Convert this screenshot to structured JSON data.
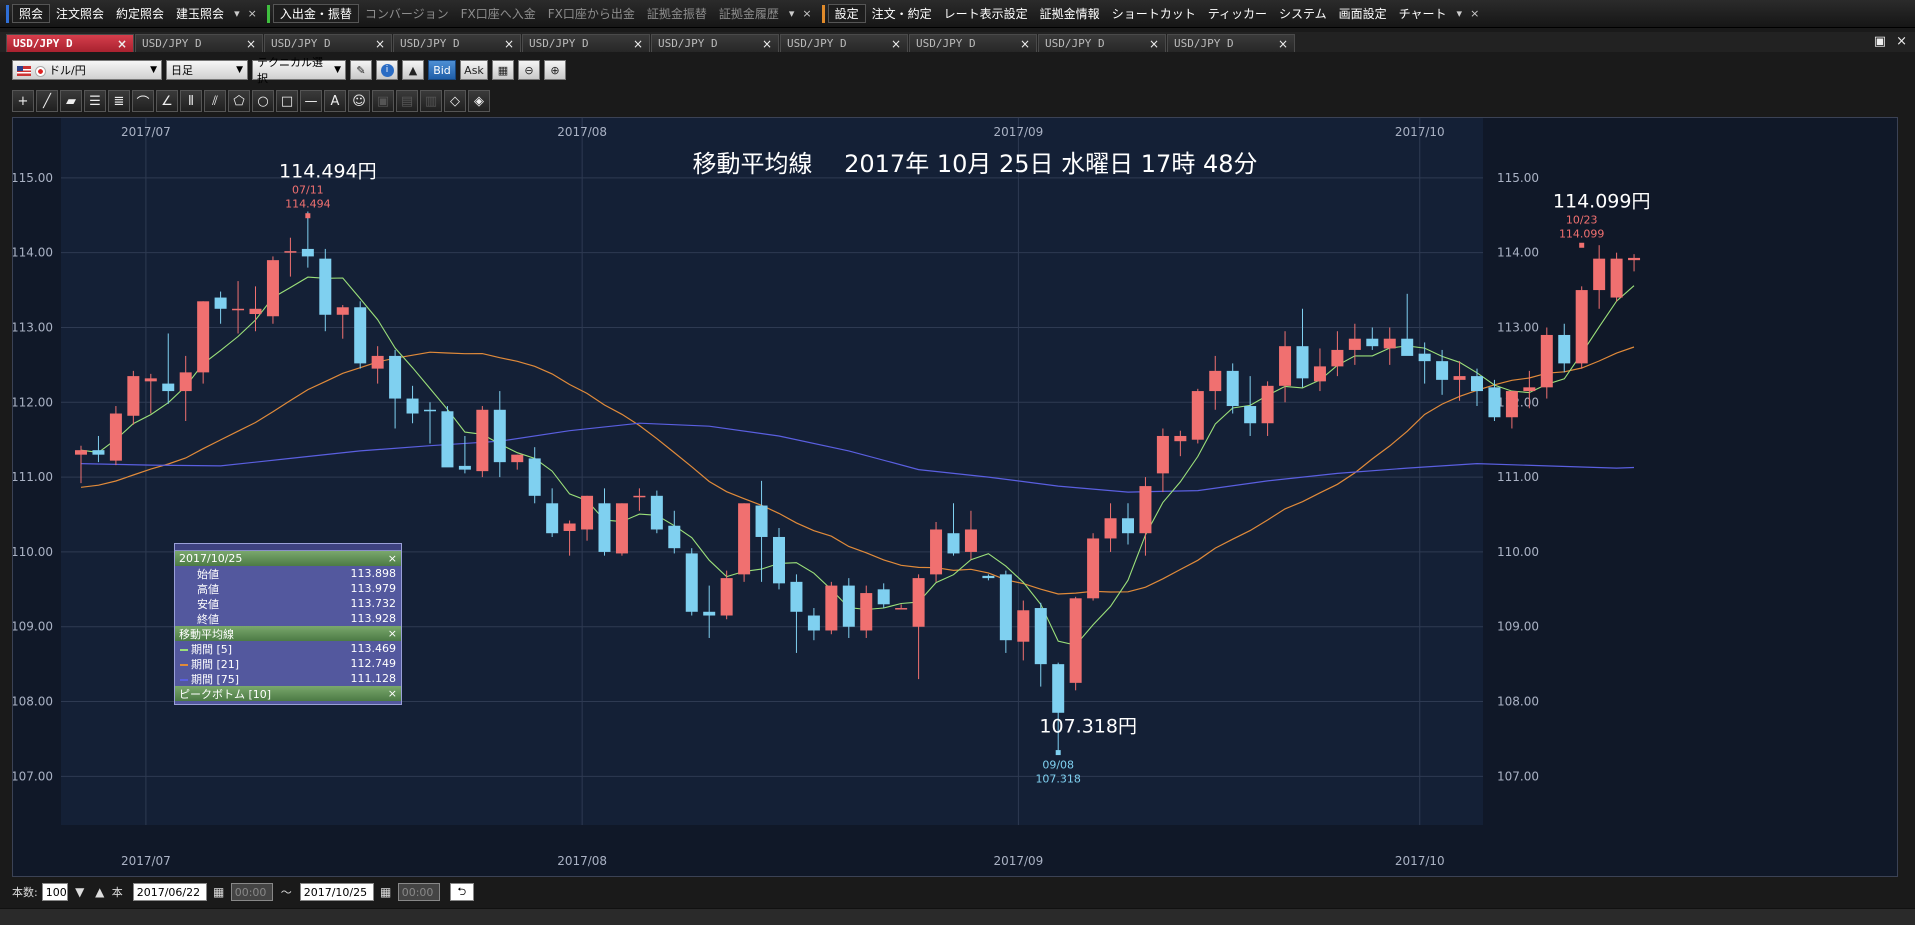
{
  "menubar": {
    "groups": [
      {
        "color": "#2f6fd6",
        "items": [
          {
            "label": "照会",
            "boxed": true
          },
          {
            "label": "注文照会"
          },
          {
            "label": "約定照会"
          },
          {
            "label": "建玉照会"
          }
        ]
      },
      {
        "color": "#3fbf3f",
        "items": [
          {
            "label": "入出金・振替",
            "boxed": true
          },
          {
            "label": "コンバージョン",
            "dim": true
          },
          {
            "label": "FX口座へ入金",
            "dim": true
          },
          {
            "label": "FX口座から出金",
            "dim": true
          },
          {
            "label": "証拠金振替",
            "dim": true
          },
          {
            "label": "証拠金履歴",
            "dim": true
          }
        ]
      },
      {
        "color": "#e08a2a",
        "items": [
          {
            "label": "設定",
            "boxed": true
          },
          {
            "label": "注文・約定"
          },
          {
            "label": "レート表示設定"
          },
          {
            "label": "証拠金情報"
          },
          {
            "label": "ショートカット"
          },
          {
            "label": "ティッカー"
          },
          {
            "label": "システム"
          },
          {
            "label": "画面設定"
          },
          {
            "label": "チャート"
          }
        ]
      }
    ],
    "dropdown_glyph": "▾",
    "close_glyph": "×"
  },
  "tabs": [
    {
      "label": "USD/JPY D",
      "active": true
    },
    {
      "label": "USD/JPY D"
    },
    {
      "label": "USD/JPY D"
    },
    {
      "label": "USD/JPY D"
    },
    {
      "label": "USD/JPY D"
    },
    {
      "label": "USD/JPY D"
    },
    {
      "label": "USD/JPY D"
    },
    {
      "label": "USD/JPY D"
    },
    {
      "label": "USD/JPY D"
    },
    {
      "label": "USD/JPY D"
    }
  ],
  "tab_close": "×",
  "window_buttons": {
    "restore": "▣",
    "close": "×"
  },
  "toolbar": {
    "pair": "ドル/円",
    "timeframe": "日足",
    "technical": "テクニカル選択",
    "bid": "Bid",
    "ask": "Ask"
  },
  "chart_data": {
    "type": "candlestick",
    "title": "移動平均線　 2017年 10月 25日 水曜日 17時 48分",
    "x_ticks": [
      "2017/07",
      "2017/08",
      "2017/09",
      "2017/10"
    ],
    "x_tick_index": [
      2,
      27,
      52,
      75
    ],
    "y_ticks": [
      "115.00",
      "114.00",
      "113.00",
      "112.00",
      "111.00",
      "110.00",
      "109.00",
      "108.00",
      "107.00"
    ],
    "ylim": [
      106.35,
      115.8
    ],
    "ohlc": [
      [
        111.3,
        111.42,
        110.92,
        111.36
      ],
      [
        111.36,
        111.55,
        111.2,
        111.3
      ],
      [
        111.22,
        111.95,
        111.16,
        111.85
      ],
      [
        111.82,
        112.42,
        111.7,
        112.35
      ],
      [
        112.28,
        112.38,
        111.85,
        112.32
      ],
      [
        112.25,
        112.92,
        111.98,
        112.15
      ],
      [
        112.15,
        112.62,
        111.75,
        112.4
      ],
      [
        112.4,
        113.35,
        112.25,
        113.35
      ],
      [
        113.4,
        113.48,
        113.05,
        113.25
      ],
      [
        113.25,
        113.62,
        112.92,
        113.25
      ],
      [
        113.18,
        113.55,
        112.95,
        113.25
      ],
      [
        113.15,
        113.95,
        113.05,
        113.9
      ],
      [
        114.0,
        114.2,
        113.68,
        114.02
      ],
      [
        114.05,
        114.55,
        113.8,
        113.95
      ],
      [
        113.92,
        114.05,
        112.95,
        113.17
      ],
      [
        113.17,
        113.3,
        112.85,
        113.27
      ],
      [
        113.27,
        113.35,
        112.45,
        112.52
      ],
      [
        112.45,
        112.75,
        112.25,
        112.62
      ],
      [
        112.62,
        112.7,
        111.65,
        112.05
      ],
      [
        112.05,
        112.22,
        111.72,
        111.85
      ],
      [
        111.9,
        112.0,
        111.45,
        111.88
      ],
      [
        111.88,
        111.95,
        111.15,
        111.13
      ],
      [
        111.15,
        111.55,
        111.05,
        111.1
      ],
      [
        111.08,
        111.95,
        111.0,
        111.9
      ],
      [
        111.9,
        112.15,
        111.0,
        111.2
      ],
      [
        111.2,
        111.3,
        111.1,
        111.3
      ],
      [
        111.25,
        111.4,
        110.65,
        110.75
      ],
      [
        110.65,
        110.85,
        110.2,
        110.25
      ],
      [
        110.28,
        110.42,
        109.95,
        110.38
      ],
      [
        110.3,
        110.75,
        110.15,
        110.75
      ],
      [
        110.65,
        110.85,
        109.95,
        110.0
      ],
      [
        109.98,
        110.65,
        109.95,
        110.65
      ],
      [
        110.75,
        110.85,
        110.55,
        110.75
      ],
      [
        110.75,
        110.82,
        110.25,
        110.3
      ],
      [
        110.35,
        110.55,
        109.98,
        110.05
      ],
      [
        109.98,
        110.05,
        109.15,
        109.2
      ],
      [
        109.2,
        109.55,
        108.85,
        109.15
      ],
      [
        109.15,
        109.75,
        109.1,
        109.65
      ],
      [
        109.7,
        110.65,
        109.6,
        110.65
      ],
      [
        110.62,
        110.95,
        109.6,
        110.2
      ],
      [
        110.2,
        110.32,
        109.5,
        109.58
      ],
      [
        109.6,
        109.7,
        108.65,
        109.2
      ],
      [
        109.15,
        109.25,
        108.82,
        108.95
      ],
      [
        108.95,
        109.6,
        108.9,
        109.55
      ],
      [
        109.55,
        109.65,
        108.85,
        109.0
      ],
      [
        108.95,
        109.55,
        108.85,
        109.45
      ],
      [
        109.5,
        109.58,
        109.25,
        109.3
      ],
      [
        109.25,
        109.3,
        109.25,
        109.25
      ],
      [
        109.0,
        109.7,
        108.3,
        109.65
      ],
      [
        109.7,
        110.4,
        109.6,
        110.3
      ],
      [
        110.25,
        110.65,
        109.95,
        109.98
      ],
      [
        110.0,
        110.55,
        109.9,
        110.3
      ],
      [
        109.68,
        109.7,
        109.62,
        109.65
      ],
      [
        109.7,
        109.75,
        108.65,
        108.82
      ],
      [
        108.8,
        109.35,
        108.55,
        109.22
      ],
      [
        109.25,
        109.32,
        108.2,
        108.5
      ],
      [
        108.5,
        108.52,
        107.32,
        107.85
      ],
      [
        108.25,
        109.4,
        108.15,
        109.38
      ],
      [
        109.38,
        110.25,
        109.35,
        110.18
      ],
      [
        110.18,
        110.65,
        110.0,
        110.45
      ],
      [
        110.45,
        110.65,
        110.1,
        110.25
      ],
      [
        110.25,
        111.0,
        109.95,
        110.88
      ],
      [
        111.05,
        111.65,
        110.8,
        111.55
      ],
      [
        111.48,
        111.62,
        111.28,
        111.55
      ],
      [
        111.5,
        112.18,
        111.45,
        112.15
      ],
      [
        112.15,
        112.62,
        111.9,
        112.42
      ],
      [
        112.42,
        112.52,
        111.85,
        111.95
      ],
      [
        111.95,
        112.35,
        111.55,
        111.72
      ],
      [
        111.72,
        112.28,
        111.55,
        112.22
      ],
      [
        112.22,
        112.95,
        112.0,
        112.75
      ],
      [
        112.75,
        113.25,
        112.2,
        112.32
      ],
      [
        112.28,
        112.72,
        112.15,
        112.48
      ],
      [
        112.48,
        112.95,
        112.35,
        112.7
      ],
      [
        112.7,
        113.05,
        112.5,
        112.85
      ],
      [
        112.85,
        113.0,
        112.7,
        112.75
      ],
      [
        112.72,
        113.0,
        112.5,
        112.85
      ],
      [
        112.85,
        113.45,
        112.65,
        112.62
      ],
      [
        112.65,
        112.8,
        112.25,
        112.55
      ],
      [
        112.55,
        112.7,
        112.1,
        112.3
      ],
      [
        112.3,
        112.55,
        112.02,
        112.35
      ],
      [
        112.35,
        112.45,
        111.95,
        112.15
      ],
      [
        112.2,
        112.3,
        111.75,
        111.8
      ],
      [
        111.8,
        112.1,
        111.65,
        112.15
      ],
      [
        112.15,
        112.42,
        111.92,
        112.2
      ],
      [
        112.2,
        113.0,
        112.05,
        112.9
      ],
      [
        112.9,
        113.05,
        112.4,
        112.52
      ],
      [
        112.52,
        113.55,
        112.45,
        113.5
      ],
      [
        113.5,
        114.1,
        113.25,
        113.92
      ],
      [
        113.4,
        114.0,
        113.35,
        113.92
      ],
      [
        113.9,
        113.98,
        113.75,
        113.93
      ]
    ],
    "moving_averages": [
      {
        "name": "期間 [5]",
        "color": "#9be07a"
      },
      {
        "name": "期間 [21]",
        "color": "#e08a3a"
      },
      {
        "name": "期間 [75]",
        "color": "#5a5fe0"
      }
    ],
    "ma75_values": [
      [
        0,
        111.18
      ],
      [
        4,
        111.16
      ],
      [
        8,
        111.15
      ],
      [
        12,
        111.25
      ],
      [
        16,
        111.35
      ],
      [
        20,
        111.42
      ],
      [
        24,
        111.48
      ],
      [
        28,
        111.62
      ],
      [
        32,
        111.72
      ],
      [
        36,
        111.68
      ],
      [
        40,
        111.55
      ],
      [
        44,
        111.35
      ],
      [
        48,
        111.1
      ],
      [
        52,
        111.0
      ],
      [
        56,
        110.88
      ],
      [
        60,
        110.8
      ],
      [
        64,
        110.82
      ],
      [
        68,
        110.95
      ],
      [
        72,
        111.05
      ],
      [
        76,
        111.12
      ],
      [
        80,
        111.18
      ],
      [
        84,
        111.15
      ],
      [
        88,
        111.12
      ],
      [
        89,
        111.128
      ]
    ],
    "ma21_back": [
      110.7,
      110.68,
      110.66,
      110.68,
      110.7,
      110.72,
      110.75,
      110.78,
      110.8,
      110.82,
      110.85,
      110.88,
      110.9,
      110.92,
      110.94,
      110.96,
      110.98,
      111.0,
      111.02,
      111.04
    ],
    "annotations": [
      {
        "type": "high",
        "index": 13,
        "big": "114.494円",
        "date": "07/11",
        "value": "114.494",
        "price": 114.494
      },
      {
        "type": "low",
        "index": 56,
        "big": "107.318円",
        "date": "09/08",
        "value": "107.318",
        "price": 107.318
      },
      {
        "type": "high",
        "index": 86,
        "big": "114.099円",
        "date": "10/23",
        "value": "114.099",
        "price": 114.099
      }
    ],
    "up_color": "#f07070",
    "down_color": "#7fd0f0"
  },
  "info_panel": {
    "date": "2017/10/25",
    "rows": [
      {
        "label": "始値",
        "value": "113.898"
      },
      {
        "label": "高値",
        "value": "113.979"
      },
      {
        "label": "安値",
        "value": "113.732"
      },
      {
        "label": "終値",
        "value": "113.928"
      }
    ],
    "ma_header": "移動平均線",
    "ma_rows": [
      {
        "label": "期間 [5]",
        "value": "113.469",
        "color": "#9be07a"
      },
      {
        "label": "期間 [21]",
        "value": "112.749",
        "color": "#e08a3a"
      },
      {
        "label": "期間 [75]",
        "value": "111.128",
        "color": "#5a5fe0"
      }
    ],
    "peak_header": "ピークボトム [10]",
    "close": "×"
  },
  "statusbar": {
    "count_label": "本数:",
    "count_value": "100",
    "count_unit": "本",
    "from_date": "2017/06/22",
    "from_time": "00:00",
    "tilde": "〜",
    "to_date": "2017/10/25",
    "to_time": "00:00"
  }
}
